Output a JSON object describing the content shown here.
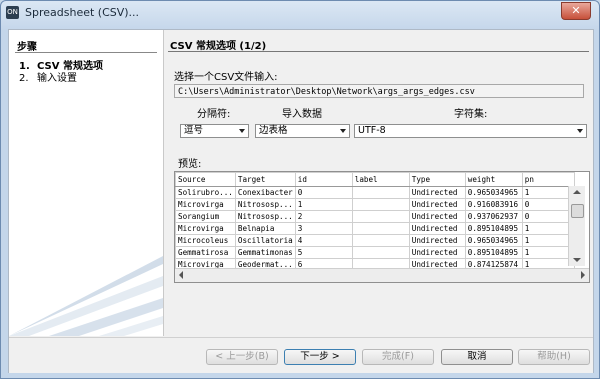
{
  "window": {
    "title": "Spreadsheet (CSV)...",
    "close_glyph": "✕"
  },
  "steps": {
    "title": "步骤",
    "items": [
      {
        "num": "1.",
        "label": "CSV 常规选项"
      },
      {
        "num": "2.",
        "label": "输入设置"
      }
    ]
  },
  "page": {
    "title": "CSV 常规选项 (1/2)",
    "file_label": "选择一个CSV文件输入:",
    "file_path": "C:\\Users\\Administrator\\Desktop\\Network\\args_args_edges.csv",
    "separator_label": "分隔符:",
    "separator_value": "逗号",
    "import_label": "导入数据",
    "import_value": "边表格",
    "charset_label": "字符集:",
    "charset_value": "UTF-8",
    "preview_label": "预览:"
  },
  "preview": {
    "columns": [
      "Source",
      "Target",
      "id",
      "label",
      "Type",
      "weight",
      "pn"
    ],
    "rows": [
      [
        "Solirubro...",
        "Conexibacter",
        "0",
        "",
        "Undirected",
        "0.965034965",
        "1"
      ],
      [
        "Microvirga",
        "Nitrososp...",
        "1",
        "",
        "Undirected",
        "0.916083916",
        "0"
      ],
      [
        "Sorangium",
        "Nitrososp...",
        "2",
        "",
        "Undirected",
        "0.937062937",
        "0"
      ],
      [
        "Microvirga",
        "Belnapia",
        "3",
        "",
        "Undirected",
        "0.895104895",
        "1"
      ],
      [
        "Microcoleus",
        "Oscillatoria",
        "4",
        "",
        "Undirected",
        "0.965034965",
        "1"
      ],
      [
        "Gemmatirosa",
        "Gemmatimonas",
        "5",
        "",
        "Undirected",
        "0.895104895",
        "1"
      ],
      [
        "Microvirga",
        "Geodermat...",
        "6",
        "",
        "Undirected",
        "0.874125874",
        "1"
      ]
    ]
  },
  "buttons": {
    "back": "< 上一步(B)",
    "next": "下一步 >",
    "finish": "完成(F)",
    "cancel": "取消",
    "help": "帮助(H)"
  },
  "icons": {
    "app": "spreadsheet-app-icon"
  }
}
